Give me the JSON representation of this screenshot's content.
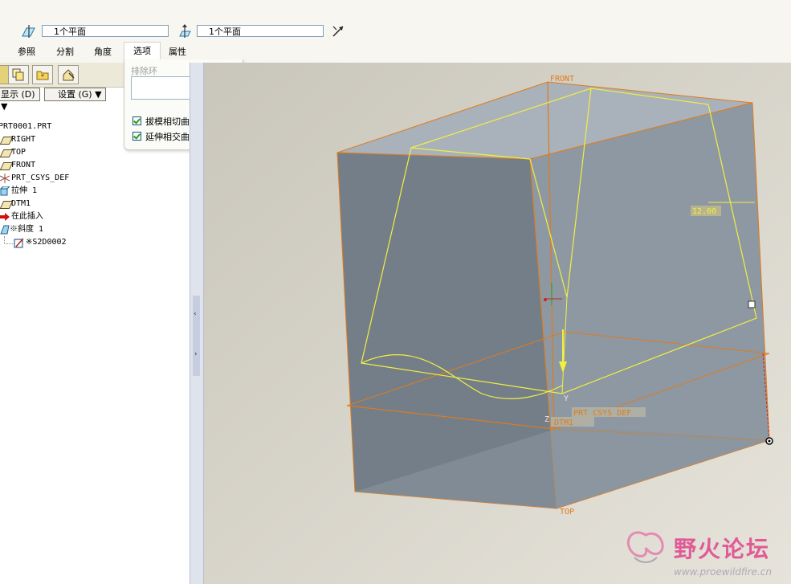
{
  "dashboard": {
    "reference_field_1": "1个平面",
    "reference_field_2": "1个平面",
    "tabs": [
      "参照",
      "分割",
      "角度",
      "选项",
      "属性"
    ]
  },
  "options_panel": {
    "exclude_loops_label": "排除环",
    "exclude_loops_value": "",
    "checkbox_1": {
      "label": "拔模相切曲面",
      "checked": true
    },
    "checkbox_2": {
      "label": "延伸相交曲面",
      "checked": true
    }
  },
  "model_tree": {
    "show_menu": "显示 (D) ▼",
    "settings_menu": "设置 (G) ▼",
    "items": [
      {
        "label": "PRT0001.PRT",
        "icon": "part-icon"
      },
      {
        "label": "RIGHT",
        "icon": "datum-plane-icon"
      },
      {
        "label": "TOP",
        "icon": "datum-plane-icon"
      },
      {
        "label": "FRONT",
        "icon": "datum-plane-icon"
      },
      {
        "label": "PRT_CSYS_DEF",
        "icon": "csys-icon"
      },
      {
        "label": "拉伸 1",
        "icon": "extrude-icon"
      },
      {
        "label": "DTM1",
        "icon": "datum-plane-icon"
      },
      {
        "label": "在此插入",
        "icon": "insert-here-arrow-icon"
      },
      {
        "label": "※斜度 1",
        "icon": "draft-icon"
      },
      {
        "label": "※S2D0002",
        "icon": "sketch-icon"
      }
    ]
  },
  "graphics": {
    "labels": {
      "front": "FRONT",
      "top": "TOP",
      "dtm1": "DTM1",
      "csys": "PRT_CSYS_DEF",
      "angle": "12.00",
      "axis_y": "Y",
      "axis_z": "Z"
    },
    "colors": {
      "background": "#d6d3c7",
      "surface_light": "#8e98a2",
      "surface_dark": "#747e89",
      "datum_plane": "#e07b1a",
      "sketch_yellow": "#f0f040"
    }
  },
  "watermark": {
    "text": "野火论坛",
    "url": "www.proewildfire.cn"
  }
}
